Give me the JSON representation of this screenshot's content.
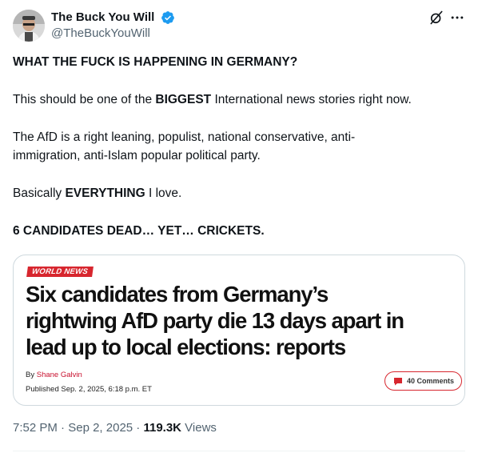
{
  "author": {
    "display_name": "The Buck You Will",
    "handle": "@TheBuckYouWill"
  },
  "tweet": {
    "line1": "WHAT THE FUCK IS HAPPENING IN GERMANY?",
    "p2_before": "This should be one of the ",
    "p2_bold": "BIGGEST",
    "p2_after": " International news stories right now.",
    "p3_line1": "The AfD is a right leaning, populist, national conservative, anti-",
    "p3_line2": "immigration, anti-Islam popular political party.",
    "p4_before": "Basically ",
    "p4_bold": "EVERYTHING",
    "p4_after": " I love.",
    "p5": "6 CANDIDATES DEAD… YET… CRICKETS."
  },
  "card": {
    "badge": "WORLD NEWS",
    "headline_line1": "Six candidates from Germany’s",
    "headline_line2": "rightwing AfD party die 13 days apart in",
    "headline_line3": "lead up to local elections: reports",
    "byline_prefix": "By ",
    "byline_author": "Shane Galvin",
    "published": "Published Sep. 2, 2025, 6:18 p.m. ET",
    "comments_label": "40 Comments"
  },
  "meta": {
    "time": "7:52 PM",
    "separator": " · ",
    "date": "Sep 2, 2025",
    "separator2": " · ",
    "views_count": "119.3K",
    "views_label": " Views"
  },
  "colors": {
    "verified": "#1d9bf0",
    "badge_red": "#d7262e",
    "muted": "#536471"
  },
  "icons": {
    "verified": "verified-badge-icon",
    "grok": "grok-icon",
    "more": "more-icon",
    "comment": "comment-bubble-icon"
  }
}
